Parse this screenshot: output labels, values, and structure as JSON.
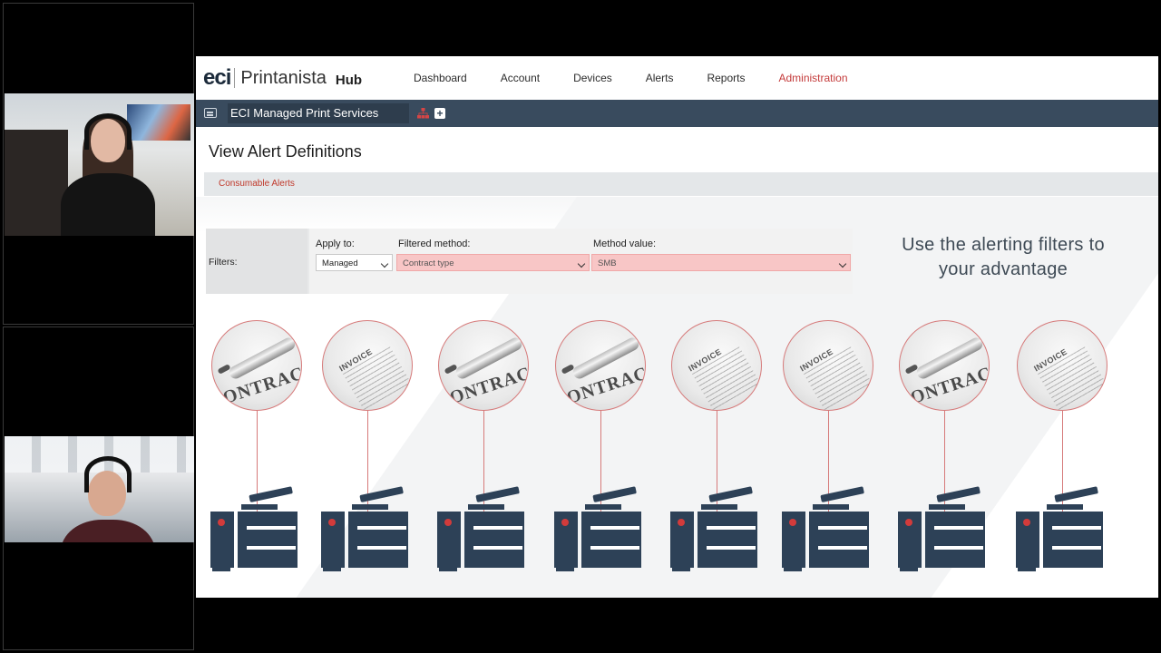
{
  "app": {
    "logo": {
      "brand": "eci",
      "product": "Printanista",
      "suffix": "Hub"
    },
    "nav": [
      "Dashboard",
      "Account",
      "Devices",
      "Alerts",
      "Reports",
      "Administration"
    ],
    "active_nav": "Administration",
    "company": "ECI Managed Print Services",
    "page_title": "View Alert Definitions",
    "tab": "Consumable Alerts",
    "filters": {
      "label": "Filters:",
      "apply_to_label": "Apply to:",
      "apply_to_value": "Managed",
      "method_label": "Filtered method:",
      "method_value": "Contract type",
      "value_label": "Method value:",
      "value_value": "SMB"
    },
    "tagline_line1": "Use the alerting filters to",
    "tagline_line2": "your advantage",
    "doc_labels": {
      "contract": "ONTRACT",
      "invoice": "INVOICE"
    }
  },
  "colors": {
    "accent": "#c0392b",
    "navy": "#394b5e",
    "printer": "#2d4157",
    "highlight": "#f8c6c6"
  },
  "icons": [
    "menu-icon",
    "org-tree-icon",
    "plus-icon",
    "chevron-down-icon",
    "pen-icon",
    "printer-icon"
  ]
}
